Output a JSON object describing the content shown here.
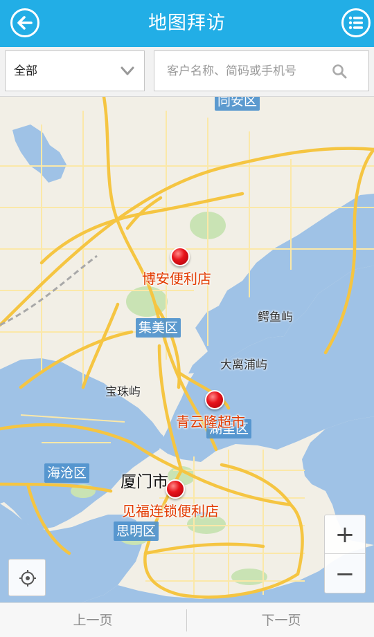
{
  "header": {
    "title": "地图拜访",
    "back_icon": "back-arrow-icon",
    "menu_icon": "list-menu-icon"
  },
  "filter": {
    "selected": "全部",
    "dropdown_icon": "chevron-down-icon"
  },
  "search": {
    "placeholder": "客户名称、简码或手机号",
    "value": "",
    "icon": "search-icon"
  },
  "map": {
    "districts": [
      "同安区",
      "集美区",
      "湖里区",
      "海沧区",
      "思明区"
    ],
    "places": [
      "鳄鱼屿",
      "大离浦屿",
      "宝珠屿"
    ],
    "city": "厦门市",
    "markers": [
      {
        "name": "博安便利店"
      },
      {
        "name": "青云隆超市"
      },
      {
        "name": "见福连锁便利店"
      }
    ],
    "colors": {
      "land": "#f2efe6",
      "water": "#9fc2e6",
      "road_major": "#f5c542",
      "road_minor": "#fbe8a8",
      "park": "#c9e3b4",
      "district_badge": "#4f93cd",
      "marker_label": "#e23a00"
    },
    "controls": {
      "zoom_in": "+",
      "zoom_out": "−",
      "locate_icon": "locate-target-icon"
    }
  },
  "footer": {
    "prev": "上一页",
    "next": "下一页"
  }
}
